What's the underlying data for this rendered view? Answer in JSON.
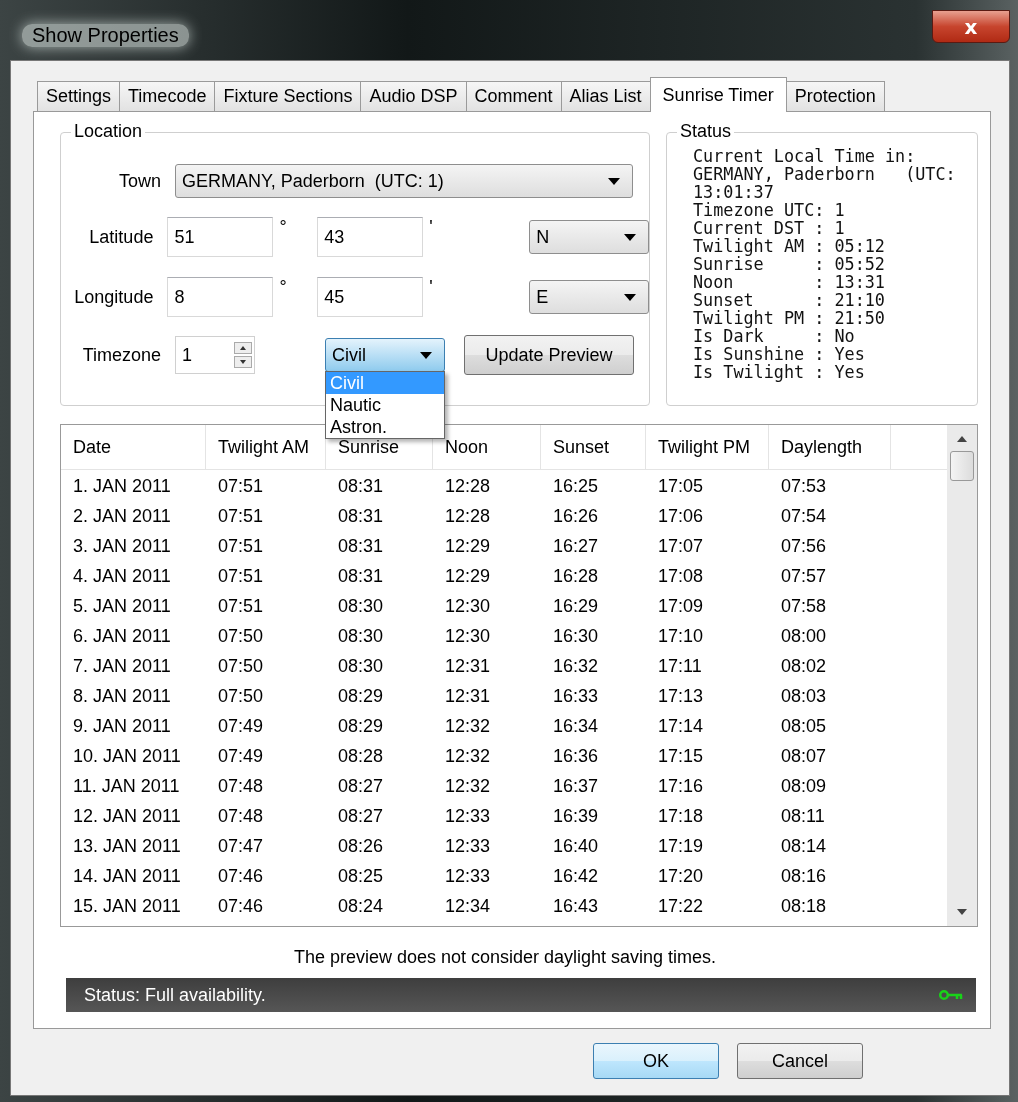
{
  "window": {
    "title": "Show Properties",
    "close": "x"
  },
  "tabs": [
    {
      "label": "Settings",
      "selected": false
    },
    {
      "label": "Timecode",
      "selected": false
    },
    {
      "label": "Fixture Sections",
      "selected": false
    },
    {
      "label": "Audio DSP",
      "selected": false
    },
    {
      "label": "Comment",
      "selected": false
    },
    {
      "label": "Alias List",
      "selected": false
    },
    {
      "label": "Sunrise Timer",
      "selected": true
    },
    {
      "label": "Protection",
      "selected": false
    }
  ],
  "location": {
    "title": "Location",
    "town": {
      "label": "Town",
      "value": "GERMANY, Paderborn  (UTC: 1)"
    },
    "latitude": {
      "label": "Latitude",
      "degrees": "51",
      "degree_unit": "°",
      "minutes": "43",
      "minute_unit": "'",
      "direction": "N"
    },
    "longitude": {
      "label": "Longitude",
      "degrees": "8",
      "degree_unit": "°",
      "minutes": "45",
      "minute_unit": "'",
      "direction": "E"
    },
    "timezone": {
      "label": "Timezone",
      "value": "1"
    },
    "twilight_type": {
      "value": "Civil",
      "expanded": true,
      "options": [
        {
          "label": "Civil",
          "selected": true
        },
        {
          "label": "Nautic",
          "selected": false
        },
        {
          "label": "Astron.",
          "selected": false
        }
      ]
    },
    "update_button": "Update Preview"
  },
  "status": {
    "title": "Status",
    "lines": [
      "Current Local Time in:",
      "GERMANY, Paderborn   (UTC:",
      "13:01:37",
      "Timezone UTC: 1",
      "Current DST : 1",
      "Twilight AM : 05:12",
      "Sunrise     : 05:52",
      "Noon        : 13:31",
      "Sunset      : 21:10",
      "Twilight PM : 21:50",
      "Is Dark     : No",
      "Is Sunshine : Yes",
      "Is Twilight : Yes"
    ]
  },
  "table": {
    "columns": [
      "Date",
      "Twilight AM",
      "Sunrise",
      "Noon",
      "Sunset",
      "Twilight PM",
      "Daylength"
    ],
    "rows": [
      [
        "1. JAN 2011",
        "07:51",
        "08:31",
        "12:28",
        "16:25",
        "17:05",
        "07:53"
      ],
      [
        "2. JAN 2011",
        "07:51",
        "08:31",
        "12:28",
        "16:26",
        "17:06",
        "07:54"
      ],
      [
        "3. JAN 2011",
        "07:51",
        "08:31",
        "12:29",
        "16:27",
        "17:07",
        "07:56"
      ],
      [
        "4. JAN 2011",
        "07:51",
        "08:31",
        "12:29",
        "16:28",
        "17:08",
        "07:57"
      ],
      [
        "5. JAN 2011",
        "07:51",
        "08:30",
        "12:30",
        "16:29",
        "17:09",
        "07:58"
      ],
      [
        "6. JAN 2011",
        "07:50",
        "08:30",
        "12:30",
        "16:30",
        "17:10",
        "08:00"
      ],
      [
        "7. JAN 2011",
        "07:50",
        "08:30",
        "12:31",
        "16:32",
        "17:11",
        "08:02"
      ],
      [
        "8. JAN 2011",
        "07:50",
        "08:29",
        "12:31",
        "16:33",
        "17:13",
        "08:03"
      ],
      [
        "9. JAN 2011",
        "07:49",
        "08:29",
        "12:32",
        "16:34",
        "17:14",
        "08:05"
      ],
      [
        "10. JAN 2011",
        "07:49",
        "08:28",
        "12:32",
        "16:36",
        "17:15",
        "08:07"
      ],
      [
        "11. JAN 2011",
        "07:48",
        "08:27",
        "12:32",
        "16:37",
        "17:16",
        "08:09"
      ],
      [
        "12. JAN 2011",
        "07:48",
        "08:27",
        "12:33",
        "16:39",
        "17:18",
        "08:11"
      ],
      [
        "13. JAN 2011",
        "07:47",
        "08:26",
        "12:33",
        "16:40",
        "17:19",
        "08:14"
      ],
      [
        "14. JAN 2011",
        "07:46",
        "08:25",
        "12:33",
        "16:42",
        "17:20",
        "08:16"
      ],
      [
        "15. JAN 2011",
        "07:46",
        "08:24",
        "12:34",
        "16:43",
        "17:22",
        "08:18"
      ]
    ]
  },
  "note": "The preview does not consider daylight saving times.",
  "status_bar": "Status: Full availability.",
  "buttons": [
    {
      "label": "OK",
      "default": true
    },
    {
      "label": "Cancel",
      "default": false
    }
  ]
}
